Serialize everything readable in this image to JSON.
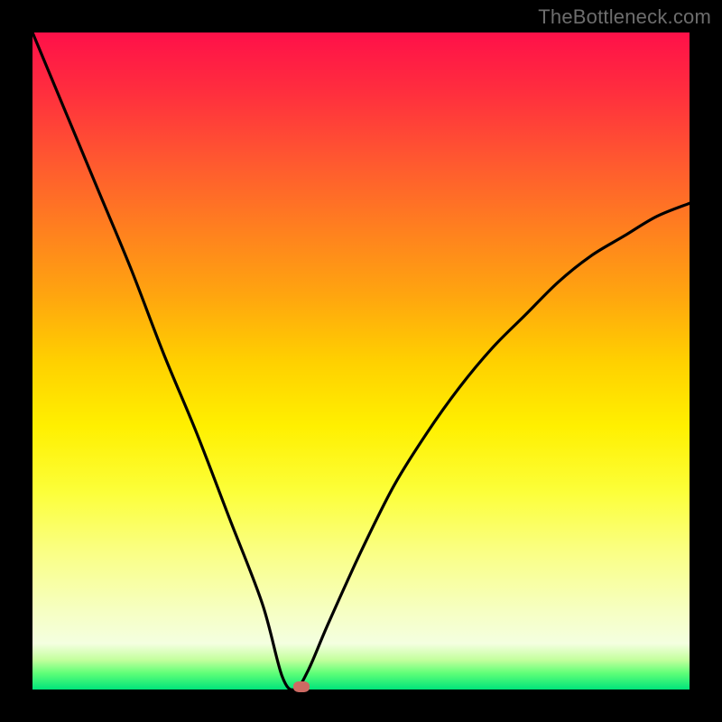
{
  "watermark": "TheBottleneck.com",
  "chart_data": {
    "type": "line",
    "title": "",
    "xlabel": "",
    "ylabel": "",
    "xlim": [
      0,
      100
    ],
    "ylim": [
      0,
      100
    ],
    "grid": false,
    "legend": false,
    "series": [
      {
        "name": "bottleneck-curve",
        "x": [
          0,
          5,
          10,
          15,
          20,
          25,
          30,
          35,
          38,
          40,
          42,
          45,
          50,
          55,
          60,
          65,
          70,
          75,
          80,
          85,
          90,
          95,
          100
        ],
        "y": [
          100,
          88,
          76,
          64,
          51,
          39,
          26,
          13,
          2,
          0,
          3,
          10,
          21,
          31,
          39,
          46,
          52,
          57,
          62,
          66,
          69,
          72,
          74
        ]
      }
    ],
    "marker": {
      "x": 41,
      "y": 0.4
    },
    "background_gradient": {
      "top": "#ff1049",
      "bottom": "#00e47a"
    }
  }
}
